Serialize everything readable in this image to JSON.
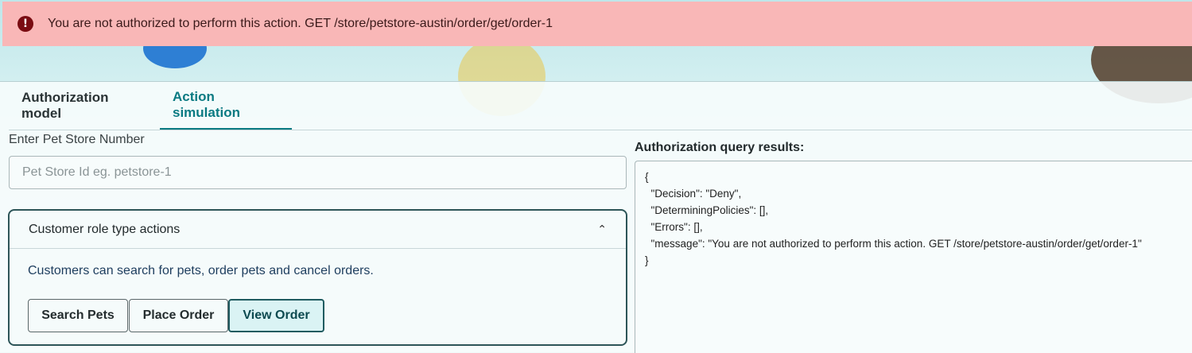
{
  "error_banner": {
    "message": "You are not authorized to perform this action. GET /store/petstore-austin/order/get/order-1",
    "icon": "exclamation-circle-icon"
  },
  "tabs": [
    {
      "label": "Authorization model",
      "active": false
    },
    {
      "label": "Action simulation",
      "active": true
    }
  ],
  "store": {
    "label": "Enter Pet Store Number",
    "placeholder": "Pet Store Id eg. petstore-1",
    "value": ""
  },
  "customer_actions": {
    "title": "Customer role type actions",
    "expanded": true,
    "description": "Customers can search for pets, order pets and cancel orders.",
    "buttons": {
      "search": "Search Pets",
      "place": "Place Order",
      "view": "View Order"
    }
  },
  "results": {
    "label": "Authorization query results:",
    "lines": [
      "{",
      "  \"Decision\": \"Deny\",",
      "  \"DeterminingPolicies\": [],",
      "  \"Errors\": [],",
      "  \"message\": \"You are not authorized to perform this action. GET /store/petstore-austin/order/get/order-1\"",
      "}"
    ]
  },
  "colors": {
    "accent": "#0a7a82",
    "error_bg": "#f9b7b7",
    "error_icon": "#7a0c12"
  }
}
